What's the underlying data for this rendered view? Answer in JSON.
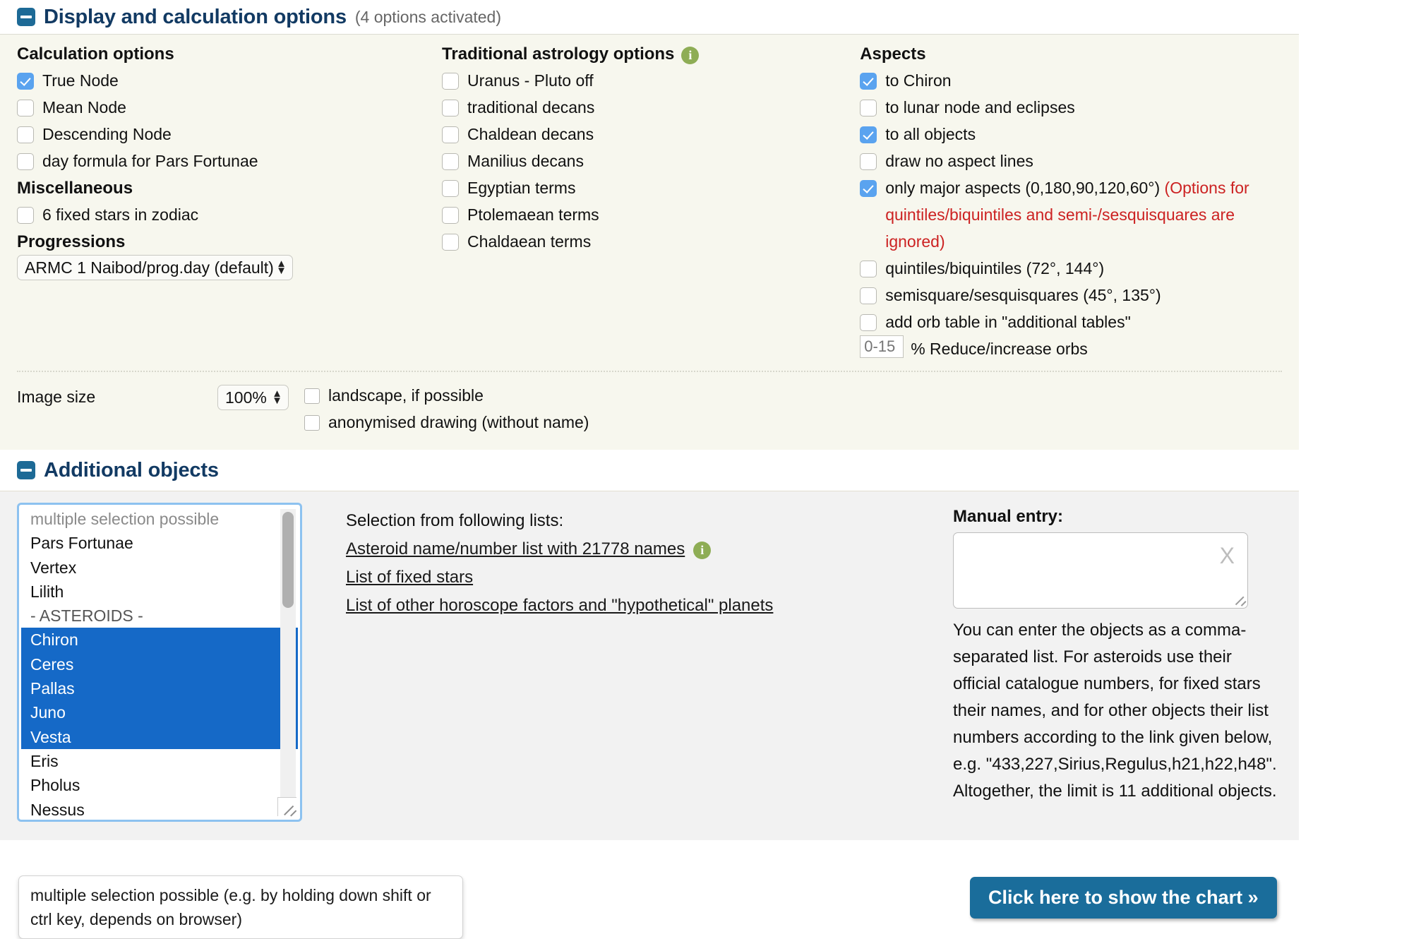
{
  "section_display": {
    "title": "Display and calculation options",
    "note": "(4 options activated)",
    "toggle_icon": "minus-icon",
    "calculation": {
      "heading": "Calculation options",
      "items": [
        {
          "label": "True Node",
          "checked": true
        },
        {
          "label": "Mean Node",
          "checked": false
        },
        {
          "label": "Descending Node",
          "checked": false
        },
        {
          "label": "day formula for Pars Fortunae",
          "checked": false
        }
      ]
    },
    "miscellaneous": {
      "heading": "Miscellaneous",
      "items": [
        {
          "label": "6 fixed stars in zodiac",
          "checked": false
        }
      ]
    },
    "progressions": {
      "heading": "Progressions",
      "selected": "ARMC 1 Naibod/prog.day (default)"
    },
    "traditional": {
      "heading": "Traditional astrology options",
      "info_icon": "info-icon",
      "items": [
        {
          "label": "Uranus - Pluto off",
          "checked": false
        },
        {
          "label": "traditional decans",
          "checked": false
        },
        {
          "label": "Chaldean decans",
          "checked": false
        },
        {
          "label": "Manilius decans",
          "checked": false
        },
        {
          "label": "Egyptian terms",
          "checked": false
        },
        {
          "label": "Ptolemaean terms",
          "checked": false
        },
        {
          "label": "Chaldaean terms",
          "checked": false
        }
      ]
    },
    "aspects": {
      "heading": "Aspects",
      "items": [
        {
          "label": "to Chiron",
          "checked": true
        },
        {
          "label": "to lunar node and eclipses",
          "checked": false
        },
        {
          "label": "to all objects",
          "checked": true
        },
        {
          "label": "draw no aspect lines",
          "checked": false
        }
      ],
      "major": {
        "label": "only major aspects (0,180,90,120,60°)",
        "note": " (Options for quintiles/biquintiles and semi-/sesquisquares are ignored)",
        "checked": true,
        "note_color": "#cc2222"
      },
      "more": [
        {
          "label": "quintiles/biquintiles (72°, 144°)",
          "checked": false
        },
        {
          "label": "semisquare/sesquisquares (45°, 135°)",
          "checked": false
        },
        {
          "label": "add orb table in \"additional tables\"",
          "checked": false
        }
      ],
      "orb": {
        "placeholder": "0-15",
        "value": "",
        "suffix": "% Reduce/increase orbs"
      }
    },
    "image_size": {
      "label": "Image size",
      "selected": "100%",
      "options": [
        {
          "label": "landscape, if possible",
          "checked": false
        },
        {
          "label": "anonymised drawing (without name)",
          "checked": false
        }
      ]
    }
  },
  "section_additional": {
    "title": "Additional objects",
    "toggle_icon": "minus-icon",
    "listbox": [
      {
        "label": "multiple selection possible",
        "type": "placeholder"
      },
      {
        "label": "Pars Fortunae",
        "type": "item"
      },
      {
        "label": "Vertex",
        "type": "item"
      },
      {
        "label": "Lilith",
        "type": "item"
      },
      {
        "label": "- ASTEROIDS -",
        "type": "group"
      },
      {
        "label": "Chiron",
        "type": "item",
        "selected": true
      },
      {
        "label": "Ceres",
        "type": "item",
        "selected": true
      },
      {
        "label": "Pallas",
        "type": "item",
        "selected": true
      },
      {
        "label": "Juno",
        "type": "item",
        "selected": true
      },
      {
        "label": "Vesta",
        "type": "item",
        "selected": true
      },
      {
        "label": "Eris",
        "type": "item"
      },
      {
        "label": "Pholus",
        "type": "item"
      },
      {
        "label": "Nessus",
        "type": "item"
      }
    ],
    "selection_lead": "Selection from following lists:",
    "links": [
      {
        "text": "Asteroid name/number list with 21778 names",
        "info_icon": "info-icon"
      },
      {
        "text": "List of fixed stars"
      },
      {
        "text": "List of other horoscope factors and \"hypothetical\" planets"
      }
    ],
    "manual": {
      "title": "Manual entry:",
      "value": "",
      "clear_icon": "X",
      "help": "You can enter the objects as a comma-separated list. For asteroids use their official catalogue numbers, for fixed stars their names, and for other objects their list numbers according to the link given below, e.g. \"433,227,Sirius,Regulus,h21,h22,h48\". Altogether, the limit is 11 additional objects."
    }
  },
  "footer": {
    "tooltip": "multiple selection possible (e.g. by holding down shift or ctrl key, depends on browser)",
    "submit_label": "Click here to show the chart »",
    "submit_color": "#1a6d9b"
  }
}
